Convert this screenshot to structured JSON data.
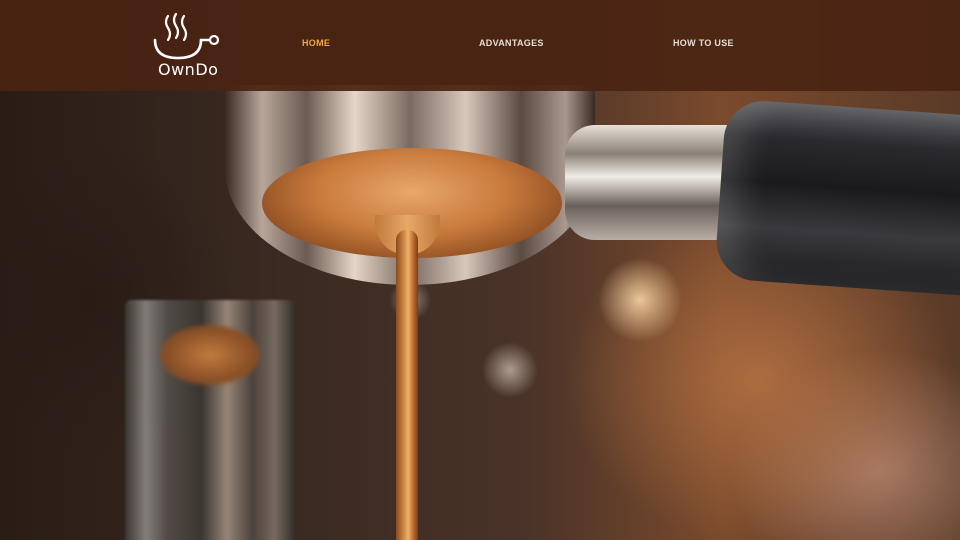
{
  "brand": {
    "name": "OwnDo"
  },
  "nav": {
    "items": [
      {
        "label": "HOME",
        "active": true
      },
      {
        "label": "ADVANTAGES",
        "active": false
      },
      {
        "label": "HOW TO USE",
        "active": false
      }
    ]
  },
  "colors": {
    "header_bg": "#4a2312",
    "nav_active": "#f0a64a",
    "nav_inactive": "#e8ddd6",
    "logo": "#ffffff"
  },
  "hero": {
    "icon": "espresso-pour-image"
  }
}
